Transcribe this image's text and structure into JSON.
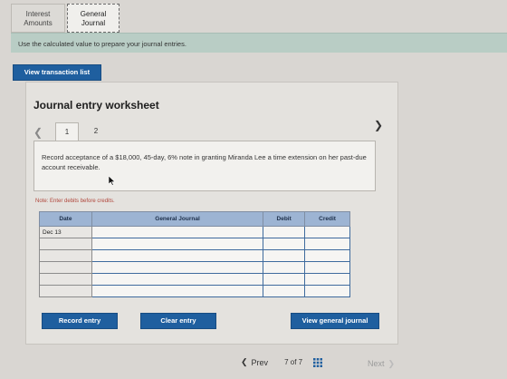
{
  "tabs": [
    {
      "label_line1": "Interest",
      "label_line2": "Amounts"
    },
    {
      "label_line1": "General",
      "label_line2": "Journal"
    }
  ],
  "notice": "Use the calculated value to prepare your journal entries.",
  "view_transaction_list": "View transaction list",
  "worksheet": {
    "title": "Journal entry worksheet",
    "steps": [
      "1",
      "2"
    ],
    "description": "Record acceptance of a $18,000, 45-day, 6% note in granting Miranda Lee a time extension on her past-due account receivable.",
    "note": "Note: Enter debits before credits."
  },
  "table": {
    "headers": [
      "Date",
      "General Journal",
      "Debit",
      "Credit"
    ],
    "rows": [
      [
        "Dec 13",
        "",
        "",
        ""
      ],
      [
        "",
        "",
        "",
        ""
      ],
      [
        "",
        "",
        "",
        ""
      ],
      [
        "",
        "",
        "",
        ""
      ],
      [
        "",
        "",
        "",
        ""
      ],
      [
        "",
        "",
        "",
        ""
      ]
    ]
  },
  "buttons": {
    "record": "Record entry",
    "clear": "Clear entry",
    "view_general_journal": "View general journal"
  },
  "pager": {
    "prev": "Prev",
    "current": "7",
    "of": "of",
    "total": "7",
    "next": "Next"
  },
  "colors": {
    "accent": "#1f5f9f",
    "header_blue": "#9db4d3",
    "note_red": "#b0463b",
    "notice_green": "#b9cdc5"
  }
}
